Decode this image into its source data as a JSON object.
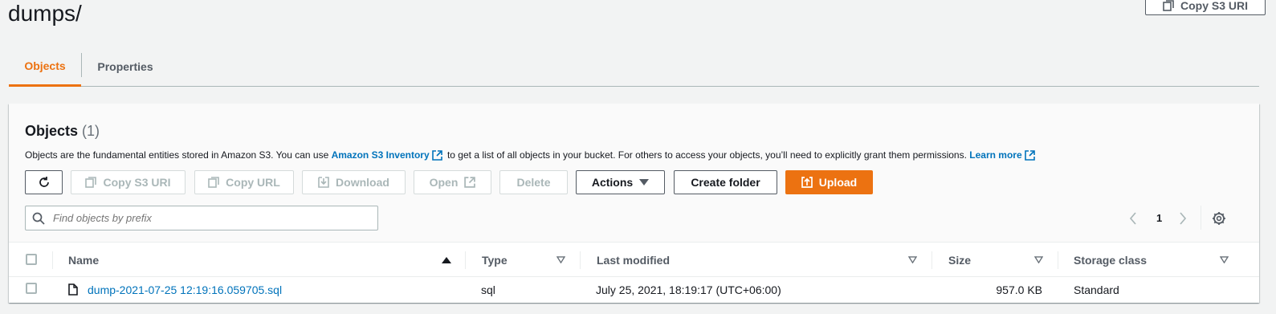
{
  "page": {
    "title": "dumps/",
    "copy_s3_uri_label": "Copy S3 URI"
  },
  "tabs": [
    {
      "label": "Objects",
      "active": true
    },
    {
      "label": "Properties",
      "active": false
    }
  ],
  "objects_panel": {
    "title": "Objects",
    "count": "(1)",
    "description": {
      "part1": "Objects are the fundamental entities stored in Amazon S3. You can use",
      "link1": "Amazon S3 Inventory",
      "part2": "to get a list of all objects in your bucket. For others to access your objects, you’ll need to explicitly grant them permissions.",
      "link2": "Learn more"
    },
    "toolbar": {
      "copy_s3_uri": "Copy S3 URI",
      "copy_url": "Copy URL",
      "download": "Download",
      "open": "Open",
      "delete": "Delete",
      "actions": "Actions",
      "create_folder": "Create folder",
      "upload": "Upload"
    },
    "search": {
      "placeholder": "Find objects by prefix",
      "value": ""
    },
    "pagination": {
      "current_page": "1"
    },
    "table": {
      "columns": [
        "Name",
        "Type",
        "Last modified",
        "Size",
        "Storage class"
      ],
      "rows": [
        {
          "name": "dump-2021-07-25 12:19:16.059705.sql",
          "type": "sql",
          "last_modified": "July 25, 2021, 18:19:17 (UTC+06:00)",
          "size": "957.0 KB",
          "storage_class": "Standard"
        }
      ]
    }
  },
  "colors": {
    "accent": "#ec7211",
    "link": "#0073bb",
    "text": "#16191f",
    "muted": "#545b64",
    "disabled": "#aab7b8"
  }
}
